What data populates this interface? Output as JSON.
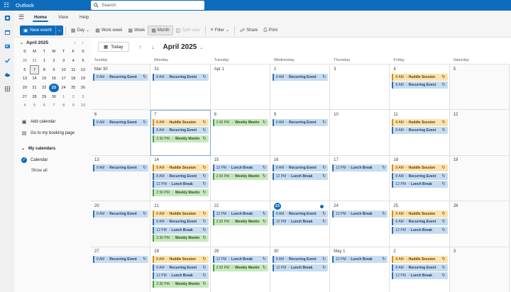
{
  "app": {
    "name": "Outlook",
    "search_placeholder": "Search"
  },
  "menu": {
    "tabs": [
      "Home",
      "View",
      "Help"
    ],
    "active": "Home"
  },
  "ribbon": {
    "new_event": "New event",
    "day": "Day",
    "work_week": "Work week",
    "week": "Week",
    "month": "Month",
    "split_view": "Split view",
    "filter": "Filter",
    "share": "Share",
    "print": "Print"
  },
  "mini_calendar": {
    "title": "April 2025",
    "weekday_letters": [
      "S",
      "M",
      "T",
      "W",
      "T",
      "F",
      "S"
    ],
    "days": [
      [
        "30",
        "31",
        "1",
        "2",
        "3",
        "4",
        "5"
      ],
      [
        "6",
        "7",
        "8",
        "9",
        "10",
        "11",
        "12"
      ],
      [
        "13",
        "14",
        "15",
        "16",
        "17",
        "18",
        "19"
      ],
      [
        "20",
        "21",
        "22",
        "23",
        "24",
        "25",
        "26"
      ],
      [
        "27",
        "28",
        "29",
        "30",
        "1",
        "2",
        "3"
      ],
      [
        "4",
        "5",
        "6",
        "7",
        "8",
        "9",
        "10"
      ]
    ],
    "today": "23"
  },
  "left_pane": {
    "add_calendar": "Add calendar",
    "booking_page": "Go to my booking page",
    "my_calendars": "My calendars",
    "calendar": "Calendar",
    "show_all": "Show all"
  },
  "calendar": {
    "today_button": "Today",
    "title": "April 2025",
    "weekdays": [
      "Sunday",
      "Monday",
      "Tuesday",
      "Wednesday",
      "Thursday",
      "Friday",
      "Saturday"
    ],
    "weeks": [
      [
        {
          "label": "Mar 30",
          "events": [
            {
              "time": "8 AM",
              "title": "Recurring Event",
              "color": "blue"
            }
          ]
        },
        {
          "label": "31",
          "events": [
            {
              "time": "8 AM",
              "title": "Recurring Event",
              "color": "blue"
            }
          ]
        },
        {
          "label": "Apr 1",
          "events": []
        },
        {
          "label": "2",
          "events": [
            {
              "time": "8 AM",
              "title": "Recurring Event",
              "color": "blue"
            }
          ]
        },
        {
          "label": "3",
          "events": []
        },
        {
          "label": "4",
          "events": [
            {
              "time": "8 AM",
              "title": "Huddle Session",
              "color": "orange"
            },
            {
              "time": "8 AM",
              "title": "Recurring Event",
              "color": "blue"
            }
          ]
        },
        {
          "label": "5",
          "events": []
        }
      ],
      [
        {
          "label": "6",
          "events": [
            {
              "time": "8 AM",
              "title": "Recurring Event",
              "color": "blue"
            }
          ]
        },
        {
          "label": "7",
          "events": [
            {
              "time": "8 AM",
              "title": "Huddle Session",
              "color": "orange"
            },
            {
              "time": "8 AM",
              "title": "Recurring Event",
              "color": "blue"
            },
            {
              "time": "2:30 PM",
              "title": "Weekly Meetin",
              "color": "green"
            }
          ]
        },
        {
          "label": "8",
          "events": [
            {
              "time": "2:30 PM",
              "title": "Weekly Meetin",
              "color": "green"
            }
          ]
        },
        {
          "label": "9",
          "events": [
            {
              "time": "8 AM",
              "title": "Recurring Event",
              "color": "blue"
            }
          ]
        },
        {
          "label": "10",
          "events": []
        },
        {
          "label": "11",
          "events": [
            {
              "time": "8 AM",
              "title": "Huddle Session",
              "color": "orange"
            },
            {
              "time": "8 AM",
              "title": "Recurring Event",
              "color": "blue"
            }
          ]
        },
        {
          "label": "12",
          "events": []
        }
      ],
      [
        {
          "label": "13",
          "events": [
            {
              "time": "8 AM",
              "title": "Recurring Event",
              "color": "blue"
            }
          ]
        },
        {
          "label": "14",
          "events": [
            {
              "time": "8 AM",
              "title": "Huddle Session",
              "color": "orange"
            },
            {
              "time": "8 AM",
              "title": "Recurring Event",
              "color": "blue"
            },
            {
              "time": "12 PM",
              "title": "Lunch Break",
              "color": "blue"
            },
            {
              "time": "2:30 PM",
              "title": "Weekly Meetin",
              "color": "green"
            }
          ]
        },
        {
          "label": "15",
          "events": [
            {
              "time": "12 PM",
              "title": "Lunch Break",
              "color": "blue"
            },
            {
              "time": "2:30 PM",
              "title": "Weekly Meetin",
              "color": "green"
            }
          ]
        },
        {
          "label": "16",
          "events": [
            {
              "time": "8 AM",
              "title": "Recurring Event",
              "color": "blue"
            },
            {
              "time": "12 PM",
              "title": "Lunch Break",
              "color": "blue"
            }
          ]
        },
        {
          "label": "17",
          "events": [
            {
              "time": "12 PM",
              "title": "Lunch Break",
              "color": "blue"
            }
          ]
        },
        {
          "label": "18",
          "events": [
            {
              "time": "8 AM",
              "title": "Huddle Session",
              "color": "orange"
            },
            {
              "time": "8 AM",
              "title": "Recurring Event",
              "color": "blue"
            },
            {
              "time": "12 PM",
              "title": "Lunch Break",
              "color": "blue"
            }
          ]
        },
        {
          "label": "19",
          "events": []
        }
      ],
      [
        {
          "label": "20",
          "events": [
            {
              "time": "8 AM",
              "title": "Recurring Event",
              "color": "blue"
            }
          ]
        },
        {
          "label": "21",
          "events": [
            {
              "time": "8 AM",
              "title": "Huddle Session",
              "color": "orange"
            },
            {
              "time": "8 AM",
              "title": "Recurring Event",
              "color": "blue"
            },
            {
              "time": "12 PM",
              "title": "Lunch Break",
              "color": "blue"
            },
            {
              "time": "2:30 PM",
              "title": "Weekly Meetin",
              "color": "green"
            }
          ]
        },
        {
          "label": "22",
          "events": [
            {
              "time": "12 PM",
              "title": "Lunch Break",
              "color": "blue"
            },
            {
              "time": "2:30 PM",
              "title": "Weekly Meetin",
              "color": "green"
            }
          ]
        },
        {
          "label": "23",
          "today": true,
          "events": [
            {
              "time": "8 AM",
              "title": "Recurring Event",
              "color": "blue"
            },
            {
              "time": "12 PM",
              "title": "Lunch Break",
              "color": "blue"
            }
          ]
        },
        {
          "label": "24",
          "events": [
            {
              "time": "12 PM",
              "title": "Lunch Break",
              "color": "blue"
            }
          ]
        },
        {
          "label": "25",
          "events": [
            {
              "time": "8 AM",
              "title": "Huddle Session",
              "color": "orange"
            },
            {
              "time": "8 AM",
              "title": "Recurring Event",
              "color": "blue"
            },
            {
              "time": "12 PM",
              "title": "Lunch Break",
              "color": "blue"
            }
          ]
        },
        {
          "label": "26",
          "events": []
        }
      ],
      [
        {
          "label": "27",
          "events": [
            {
              "time": "8 AM",
              "title": "Recurring Event",
              "color": "blue"
            }
          ]
        },
        {
          "label": "28",
          "events": [
            {
              "time": "8 AM",
              "title": "Huddle Session",
              "color": "orange"
            },
            {
              "time": "8 AM",
              "title": "Recurring Event",
              "color": "blue"
            },
            {
              "time": "12 PM",
              "title": "Lunch Break",
              "color": "blue"
            },
            {
              "time": "2:30 PM",
              "title": "Weekly Meetin",
              "color": "green"
            }
          ]
        },
        {
          "label": "29",
          "events": [
            {
              "time": "12 PM",
              "title": "Lunch Break",
              "color": "blue"
            },
            {
              "time": "2:30 PM",
              "title": "Weekly Meetin",
              "color": "green"
            }
          ]
        },
        {
          "label": "30",
          "events": [
            {
              "time": "8 AM",
              "title": "Recurring Event",
              "color": "blue"
            },
            {
              "time": "12 PM",
              "title": "Lunch Break",
              "color": "blue"
            }
          ]
        },
        {
          "label": "May 1",
          "events": [
            {
              "time": "12 PM",
              "title": "Lunch Break",
              "color": "blue"
            }
          ]
        },
        {
          "label": "2",
          "events": [
            {
              "time": "8 AM",
              "title": "Huddle Session",
              "color": "orange"
            },
            {
              "time": "8 AM",
              "title": "Recurring Event",
              "color": "blue"
            },
            {
              "time": "12 PM",
              "title": "Lunch Break",
              "color": "blue"
            }
          ]
        },
        {
          "label": "3",
          "events": []
        }
      ]
    ]
  },
  "colors": {
    "brand": "#0f6cbd",
    "event_blue": "#c7dcf0",
    "event_orange": "#fbe3b0",
    "event_green": "#c9e8c0"
  }
}
